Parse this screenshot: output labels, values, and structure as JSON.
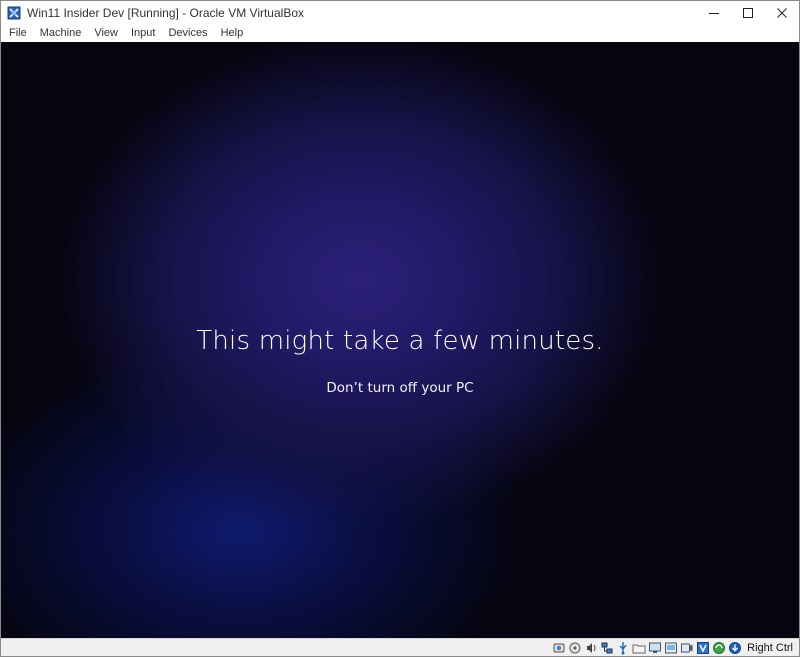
{
  "window": {
    "title": "Win11 Insider Dev [Running] - Oracle VM VirtualBox"
  },
  "menu": {
    "items": [
      "File",
      "Machine",
      "View",
      "Input",
      "Devices",
      "Help"
    ]
  },
  "guest": {
    "headline": "This might take a few minutes.",
    "subline": "Don’t turn off your PC",
    "background_color": "#05050f",
    "glow_color": "#2b1f7a"
  },
  "statusbar": {
    "icons": [
      "hard-disk-icon",
      "optical-drive-icon",
      "audio-icon",
      "network-icon",
      "usb-icon",
      "shared-folders-icon",
      "display-icon",
      "recording-icon",
      "video-capture-icon",
      "cpu-virtualization-icon",
      "guest-additions-icon",
      "mouse-integration-icon"
    ],
    "host_key": "Right Ctrl"
  }
}
